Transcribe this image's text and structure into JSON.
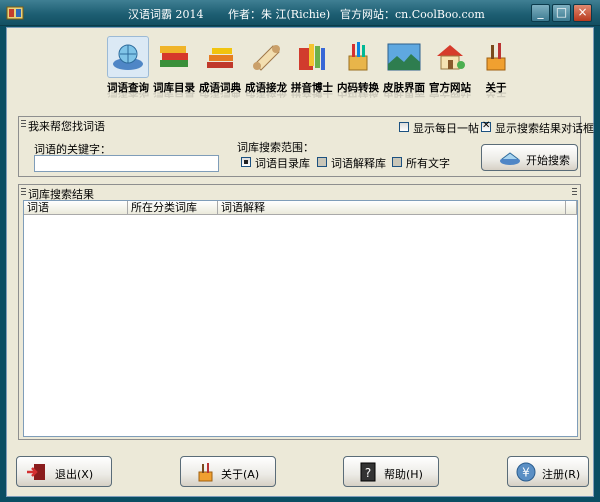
{
  "titlebar": {
    "app_name": "汉语词霸 2014",
    "author": "作者：朱 江(Richie)",
    "website": "官方网站：cn.CoolBoo.com",
    "buttons": [
      "_",
      "□",
      "×"
    ]
  },
  "toolbar": {
    "items": [
      {
        "label": "词语查询",
        "icon": "globe-book-icon",
        "active": true
      },
      {
        "label": "词库目录",
        "icon": "book-stack-icon"
      },
      {
        "label": "成语词典",
        "icon": "books-icon"
      },
      {
        "label": "成语接龙",
        "icon": "scroll-icon"
      },
      {
        "label": "拼音博士",
        "icon": "crayon-book-icon"
      },
      {
        "label": "内码转换",
        "icon": "pencil-cup-icon"
      },
      {
        "label": "皮肤界面",
        "icon": "landscape-icon"
      },
      {
        "label": "官方网站",
        "icon": "house-icon"
      },
      {
        "label": "关于",
        "icon": "brush-icon"
      }
    ]
  },
  "search": {
    "group_title": "我来帮您找词语",
    "show_daily_tip": "显示每日一帖",
    "show_result_dialog": "显示搜索结果对话框",
    "keyword_label": "词语的关键字：",
    "keyword_value": "",
    "scope_label": "词库搜索范围：",
    "scope_options": [
      "词语目录库",
      "词语解释库",
      "所有文字"
    ],
    "start_button": "开始搜索"
  },
  "results": {
    "group_title": "词库搜索结果",
    "columns": [
      "词语",
      "所在分类词库",
      "词语解释"
    ]
  },
  "bottom": {
    "exit": "退出(X)",
    "about": "关于(A)",
    "help": "帮助(H)",
    "register": "注册(R)"
  }
}
